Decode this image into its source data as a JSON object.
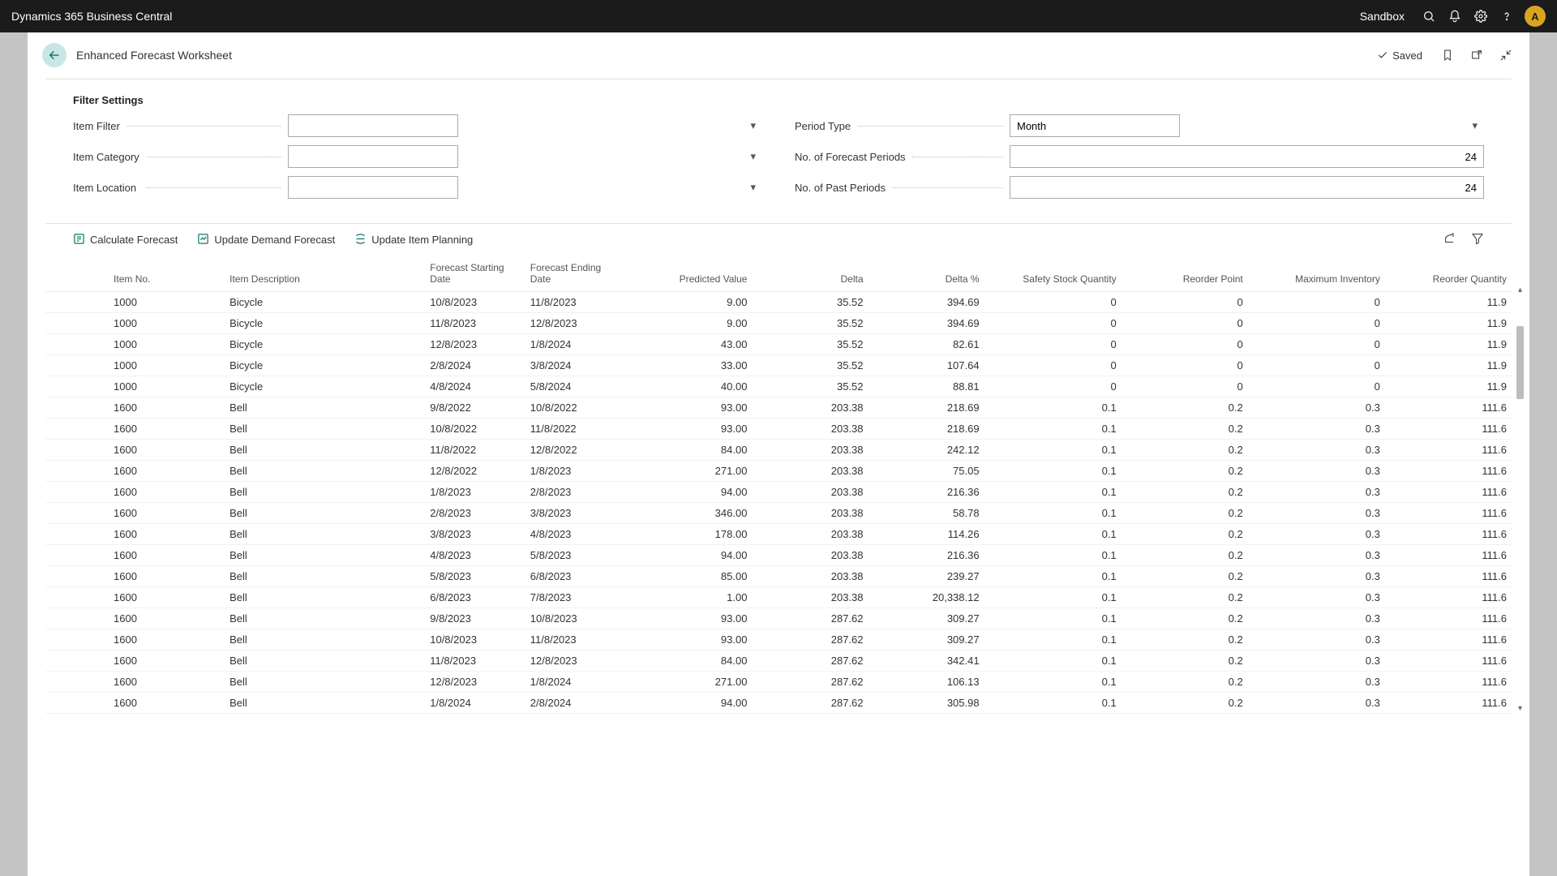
{
  "topbar": {
    "title": "Dynamics 365 Business Central",
    "environment": "Sandbox",
    "avatar_initial": "A"
  },
  "page": {
    "title": "Enhanced Forecast Worksheet",
    "saved_label": "Saved"
  },
  "filter": {
    "heading": "Filter Settings",
    "item_filter_label": "Item Filter",
    "item_filter_value": "",
    "item_category_label": "Item Category",
    "item_category_value": "",
    "item_location_label": "Item Location",
    "item_location_value": "",
    "period_type_label": "Period Type",
    "period_type_value": "Month",
    "forecast_periods_label": "No. of Forecast Periods",
    "forecast_periods_value": "24",
    "past_periods_label": "No. of Past Periods",
    "past_periods_value": "24"
  },
  "actions": {
    "calculate": "Calculate Forecast",
    "update_demand": "Update Demand Forecast",
    "update_planning": "Update Item Planning"
  },
  "columns": {
    "item_no": "Item No.",
    "item_desc": "Item Description",
    "fc_start": "Forecast Starting Date",
    "fc_end": "Forecast Ending Date",
    "predicted": "Predicted Value",
    "delta": "Delta",
    "delta_pct": "Delta %",
    "safety": "Safety Stock Quantity",
    "reorder_point": "Reorder Point",
    "max_inv": "Maximum Inventory",
    "reorder_qty": "Reorder Quantity"
  },
  "rows": [
    {
      "item_no": "1000",
      "item_desc": "Bicycle",
      "fc_start": "10/8/2023",
      "fc_end": "11/8/2023",
      "predicted": "9.00",
      "delta": "35.52",
      "delta_pct": "394.69",
      "safety": "0",
      "reorder_point": "0",
      "max_inv": "0",
      "reorder_qty": "11.9"
    },
    {
      "item_no": "1000",
      "item_desc": "Bicycle",
      "fc_start": "11/8/2023",
      "fc_end": "12/8/2023",
      "predicted": "9.00",
      "delta": "35.52",
      "delta_pct": "394.69",
      "safety": "0",
      "reorder_point": "0",
      "max_inv": "0",
      "reorder_qty": "11.9"
    },
    {
      "item_no": "1000",
      "item_desc": "Bicycle",
      "fc_start": "12/8/2023",
      "fc_end": "1/8/2024",
      "predicted": "43.00",
      "delta": "35.52",
      "delta_pct": "82.61",
      "safety": "0",
      "reorder_point": "0",
      "max_inv": "0",
      "reorder_qty": "11.9"
    },
    {
      "item_no": "1000",
      "item_desc": "Bicycle",
      "fc_start": "2/8/2024",
      "fc_end": "3/8/2024",
      "predicted": "33.00",
      "delta": "35.52",
      "delta_pct": "107.64",
      "safety": "0",
      "reorder_point": "0",
      "max_inv": "0",
      "reorder_qty": "11.9"
    },
    {
      "item_no": "1000",
      "item_desc": "Bicycle",
      "fc_start": "4/8/2024",
      "fc_end": "5/8/2024",
      "predicted": "40.00",
      "delta": "35.52",
      "delta_pct": "88.81",
      "safety": "0",
      "reorder_point": "0",
      "max_inv": "0",
      "reorder_qty": "11.9"
    },
    {
      "item_no": "1600",
      "item_desc": "Bell",
      "fc_start": "9/8/2022",
      "fc_end": "10/8/2022",
      "predicted": "93.00",
      "delta": "203.38",
      "delta_pct": "218.69",
      "safety": "0.1",
      "reorder_point": "0.2",
      "max_inv": "0.3",
      "reorder_qty": "111.6"
    },
    {
      "item_no": "1600",
      "item_desc": "Bell",
      "fc_start": "10/8/2022",
      "fc_end": "11/8/2022",
      "predicted": "93.00",
      "delta": "203.38",
      "delta_pct": "218.69",
      "safety": "0.1",
      "reorder_point": "0.2",
      "max_inv": "0.3",
      "reorder_qty": "111.6"
    },
    {
      "item_no": "1600",
      "item_desc": "Bell",
      "fc_start": "11/8/2022",
      "fc_end": "12/8/2022",
      "predicted": "84.00",
      "delta": "203.38",
      "delta_pct": "242.12",
      "safety": "0.1",
      "reorder_point": "0.2",
      "max_inv": "0.3",
      "reorder_qty": "111.6"
    },
    {
      "item_no": "1600",
      "item_desc": "Bell",
      "fc_start": "12/8/2022",
      "fc_end": "1/8/2023",
      "predicted": "271.00",
      "delta": "203.38",
      "delta_pct": "75.05",
      "safety": "0.1",
      "reorder_point": "0.2",
      "max_inv": "0.3",
      "reorder_qty": "111.6"
    },
    {
      "item_no": "1600",
      "item_desc": "Bell",
      "fc_start": "1/8/2023",
      "fc_end": "2/8/2023",
      "predicted": "94.00",
      "delta": "203.38",
      "delta_pct": "216.36",
      "safety": "0.1",
      "reorder_point": "0.2",
      "max_inv": "0.3",
      "reorder_qty": "111.6"
    },
    {
      "item_no": "1600",
      "item_desc": "Bell",
      "fc_start": "2/8/2023",
      "fc_end": "3/8/2023",
      "predicted": "346.00",
      "delta": "203.38",
      "delta_pct": "58.78",
      "safety": "0.1",
      "reorder_point": "0.2",
      "max_inv": "0.3",
      "reorder_qty": "111.6"
    },
    {
      "item_no": "1600",
      "item_desc": "Bell",
      "fc_start": "3/8/2023",
      "fc_end": "4/8/2023",
      "predicted": "178.00",
      "delta": "203.38",
      "delta_pct": "114.26",
      "safety": "0.1",
      "reorder_point": "0.2",
      "max_inv": "0.3",
      "reorder_qty": "111.6"
    },
    {
      "item_no": "1600",
      "item_desc": "Bell",
      "fc_start": "4/8/2023",
      "fc_end": "5/8/2023",
      "predicted": "94.00",
      "delta": "203.38",
      "delta_pct": "216.36",
      "safety": "0.1",
      "reorder_point": "0.2",
      "max_inv": "0.3",
      "reorder_qty": "111.6"
    },
    {
      "item_no": "1600",
      "item_desc": "Bell",
      "fc_start": "5/8/2023",
      "fc_end": "6/8/2023",
      "predicted": "85.00",
      "delta": "203.38",
      "delta_pct": "239.27",
      "safety": "0.1",
      "reorder_point": "0.2",
      "max_inv": "0.3",
      "reorder_qty": "111.6"
    },
    {
      "item_no": "1600",
      "item_desc": "Bell",
      "fc_start": "6/8/2023",
      "fc_end": "7/8/2023",
      "predicted": "1.00",
      "delta": "203.38",
      "delta_pct": "20,338.12",
      "safety": "0.1",
      "reorder_point": "0.2",
      "max_inv": "0.3",
      "reorder_qty": "111.6"
    },
    {
      "item_no": "1600",
      "item_desc": "Bell",
      "fc_start": "9/8/2023",
      "fc_end": "10/8/2023",
      "predicted": "93.00",
      "delta": "287.62",
      "delta_pct": "309.27",
      "safety": "0.1",
      "reorder_point": "0.2",
      "max_inv": "0.3",
      "reorder_qty": "111.6"
    },
    {
      "item_no": "1600",
      "item_desc": "Bell",
      "fc_start": "10/8/2023",
      "fc_end": "11/8/2023",
      "predicted": "93.00",
      "delta": "287.62",
      "delta_pct": "309.27",
      "safety": "0.1",
      "reorder_point": "0.2",
      "max_inv": "0.3",
      "reorder_qty": "111.6"
    },
    {
      "item_no": "1600",
      "item_desc": "Bell",
      "fc_start": "11/8/2023",
      "fc_end": "12/8/2023",
      "predicted": "84.00",
      "delta": "287.62",
      "delta_pct": "342.41",
      "safety": "0.1",
      "reorder_point": "0.2",
      "max_inv": "0.3",
      "reorder_qty": "111.6"
    },
    {
      "item_no": "1600",
      "item_desc": "Bell",
      "fc_start": "12/8/2023",
      "fc_end": "1/8/2024",
      "predicted": "271.00",
      "delta": "287.62",
      "delta_pct": "106.13",
      "safety": "0.1",
      "reorder_point": "0.2",
      "max_inv": "0.3",
      "reorder_qty": "111.6"
    },
    {
      "item_no": "1600",
      "item_desc": "Bell",
      "fc_start": "1/8/2024",
      "fc_end": "2/8/2024",
      "predicted": "94.00",
      "delta": "287.62",
      "delta_pct": "305.98",
      "safety": "0.1",
      "reorder_point": "0.2",
      "max_inv": "0.3",
      "reorder_qty": "111.6"
    }
  ]
}
